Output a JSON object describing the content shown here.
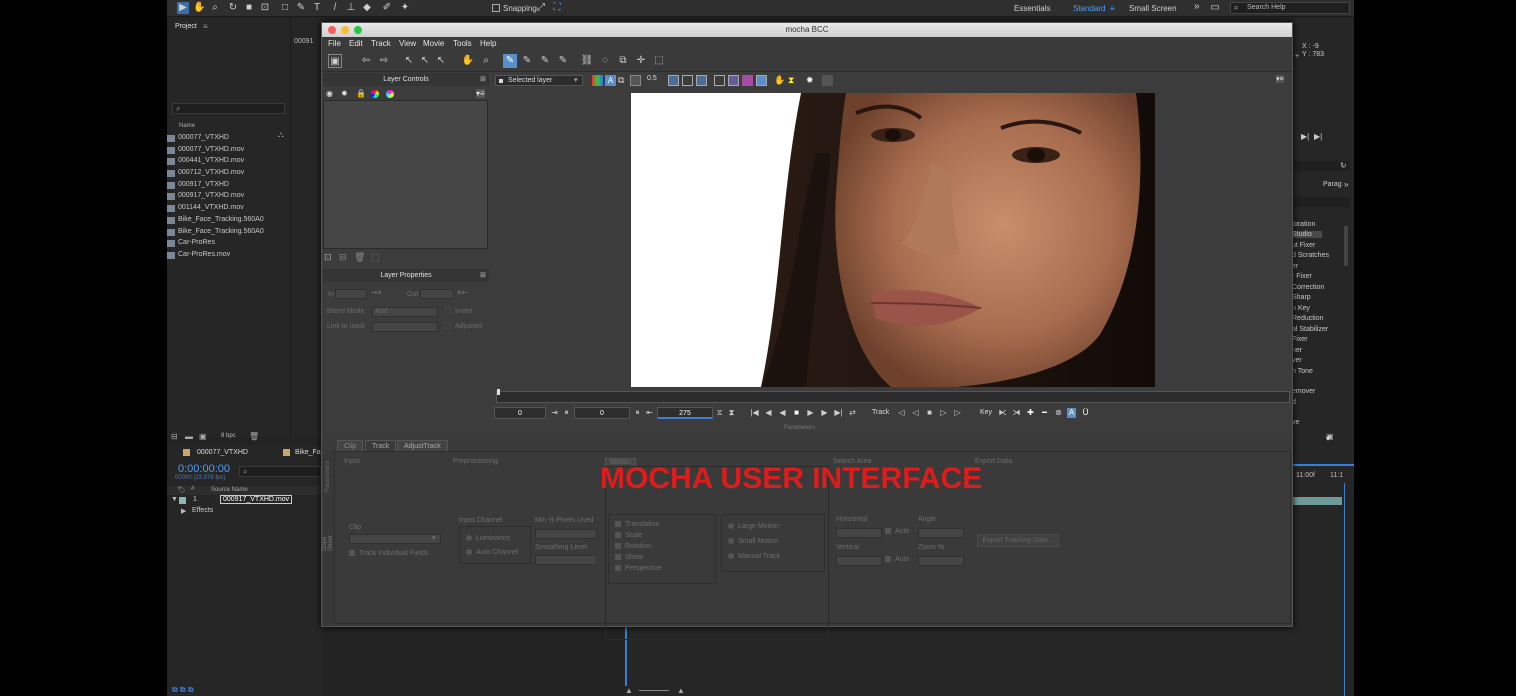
{
  "ae": {
    "workspaces": [
      "Essentials",
      "Standard",
      "Small Screen"
    ],
    "snapping_label": "Snapping",
    "search_help_placeholder": "Search Help",
    "coords": {
      "x": "X : -9",
      "y": "Y : 783"
    },
    "project": {
      "title": "Project",
      "col_name": "Name",
      "items": [
        "000077_VTXHD",
        "000077_VTXHD.mov",
        "000441_VTXHD.mov",
        "000712_VTXHD.mov",
        "000917_VTXHD",
        "000917_VTXHD.mov",
        "001144_VTXHD.mov",
        "Bike_Face_Tracking.560A0",
        "Bike_Face_Tracking.560A0",
        "Car-ProRes",
        "Car-ProRes.mov"
      ],
      "bpc": "8 bpc",
      "side_label": "00091"
    },
    "timeline": {
      "tab1": "000077_VTXHD",
      "tab2": "Bike_Fa",
      "timecode": "0:00:00:00",
      "fps": "00000 (23.976 fps)",
      "col_source": "Source Name",
      "layer_num": "1",
      "layer_name": "000917_VTXHD.mov",
      "effects": "Effects",
      "time_labels": [
        "11:00f",
        "11:1"
      ]
    },
    "right_panel": {
      "tab": "Parag",
      "items": [
        "toration",
        "Studio",
        "ut Fixer",
        "d Scratches",
        "er",
        "r Fixer",
        "Correction",
        "Sharp",
        "n Key",
        "Reduction",
        "al Stabilizer",
        "Fixer",
        "ner",
        "ver",
        "h Tone",
        "emover",
        "d",
        "ve"
      ]
    }
  },
  "mocha": {
    "title": "mocha BCC",
    "menu": [
      "File",
      "Edit",
      "Track",
      "View",
      "Movie",
      "Tools",
      "Help"
    ],
    "layer_controls": "Layer Controls",
    "layer_properties": "Layer Properties",
    "lp": {
      "in": "In",
      "out": "Out",
      "blend_mode": "Blend Mode",
      "blend_value": "Add",
      "invert": "Invert",
      "link_to_track": "Link to track",
      "adjusted": "Adjusted"
    },
    "view_selector": "Selected layer",
    "opacity": "0.5",
    "timecodes": {
      "in": "0",
      "current": "0",
      "out": "275"
    },
    "track_label": "Track",
    "key_label": "Key",
    "params_title": "Parameters",
    "tabs": [
      "Clip",
      "Track",
      "AdjustTrack"
    ],
    "sections": {
      "input": "Input",
      "preprocessing": "Preprocessing",
      "motion": "Motion",
      "search_area": "Search Area",
      "export_data": "Export Data"
    },
    "input": {
      "clip": "Clip",
      "track_fields": "Track Individual Fields"
    },
    "pre": {
      "input_channel": "Input Channel",
      "luminance": "Luminance",
      "auto_channel": "Auto Channel",
      "min_pixels": "Min % Pixels Used",
      "smoothing": "Smoothing Level"
    },
    "motion": {
      "items": [
        "Translation",
        "Scale",
        "Rotation",
        "Shear",
        "Perspective"
      ],
      "modes": [
        "Large Motion",
        "Small Motion",
        "Manual Track"
      ]
    },
    "search": {
      "horizontal": "Horizontal",
      "vertical": "Vertical",
      "auto": "Auto",
      "angle": "Angle",
      "zoom": "Zoom %"
    },
    "export": {
      "button": "Export Tracking Data..."
    },
    "dope_sheet": "Dope Sheet",
    "params_side": "Parameters"
  },
  "overlay": {
    "text": "MOCHA USER INTERFACE"
  }
}
